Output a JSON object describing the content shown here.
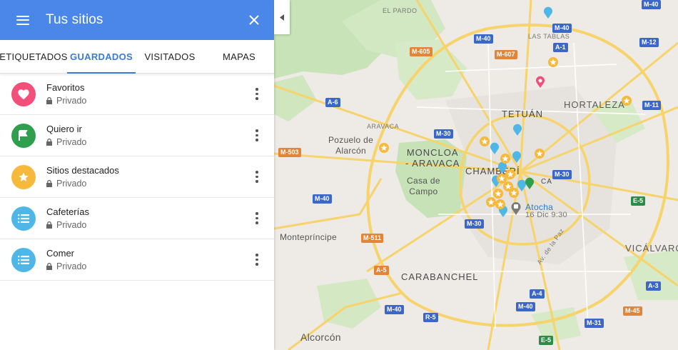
{
  "panel": {
    "title": "Tus sitios",
    "menu_icon": "menu-icon",
    "close_icon": "close-icon"
  },
  "tabs": [
    {
      "label": "ETIQUETADOS",
      "active": false
    },
    {
      "label": "GUARDADOS",
      "active": true
    },
    {
      "label": "VISITADOS",
      "active": false
    },
    {
      "label": "MAPAS",
      "active": false
    }
  ],
  "lists": [
    {
      "name": "Favoritos",
      "privacy": "Privado",
      "icon": "heart-icon",
      "color": "#f24f7a"
    },
    {
      "name": "Quiero ir",
      "privacy": "Privado",
      "icon": "flag-icon",
      "color": "#2f9e4d"
    },
    {
      "name": "Sitios destacados",
      "privacy": "Privado",
      "icon": "star-icon",
      "color": "#f6b93b"
    },
    {
      "name": "Cafeterías",
      "privacy": "Privado",
      "icon": "list-icon",
      "color": "#4fb7e8"
    },
    {
      "name": "Comer",
      "privacy": "Privado",
      "icon": "list-icon",
      "color": "#4fb7e8"
    }
  ],
  "map": {
    "places": {
      "el_pardo": "EL PARDO",
      "las_tablas": "LAS TABLAS",
      "hortaleza": "HORTALEZA",
      "tetuan": "TETUÁN",
      "aravaca": "ARAVACA",
      "pozuelo": "Pozuelo de\nAlarcón",
      "moncloa": "MONCLOA\n- ARAVACA",
      "chamberi": "CHAMBERÍ",
      "casa_campo": "Casa de\nCampo",
      "atocha": "Atocha",
      "atocha_date": "16 Dic 9:30",
      "montepríncipe": "Montepríncipe",
      "carabanchel": "CARABANCHEL",
      "vicalvaro": "VICÁLVARO",
      "alcorcon": "Alcorcón",
      "av_paz": "Av. de la Paz",
      "partial_left": "CA"
    },
    "roads": {
      "m40_top": "M-40",
      "m40_tablas": "M-40",
      "a1": "A-1",
      "m12": "M-12",
      "m605": "M-605",
      "m607": "M-607",
      "a6": "A-6",
      "m11": "M-11",
      "m30_nw": "M-30",
      "m503": "M-503",
      "m30_e": "M-30",
      "m40_w": "M-40",
      "e5_e": "E-5",
      "m511": "M-511",
      "m30_s": "M-30",
      "a5": "A-5",
      "a4": "A-4",
      "a3": "A-3",
      "m40_sw": "M-40",
      "r5": "R-5",
      "m40_s": "M-40",
      "m45": "M-45",
      "m31": "M-31",
      "e5_s": "E-5",
      "m40_ne": "M-40"
    }
  }
}
